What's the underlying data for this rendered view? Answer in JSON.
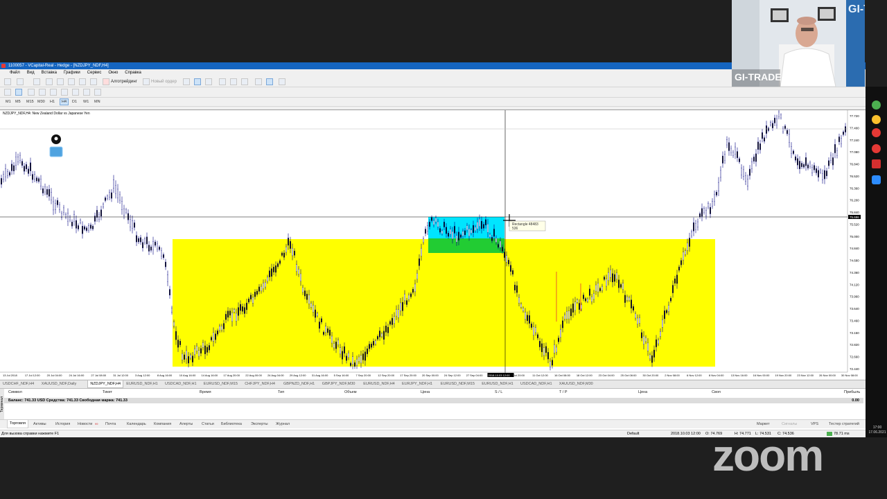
{
  "window": {
    "title": "1100057 - VCapital-Real - Hedge - [NZDJPY_NDF,H4]"
  },
  "menu": [
    "Файл",
    "Вид",
    "Вставка",
    "Графики",
    "Сервис",
    "Окно",
    "Справка"
  ],
  "toolbar": {
    "algotrading_label": "Алготрейдинг",
    "new_order_label": "Новый ордер"
  },
  "timeframes": [
    "M1",
    "M5",
    "M15",
    "M30",
    "H1",
    "H4",
    "D1",
    "W1",
    "MN"
  ],
  "active_timeframe": "H4",
  "chart": {
    "title": "NZDJPY_NDF,H4: New Zealand Dollar vs Japanese Yen",
    "tooltip_name": "Rectangle 48483",
    "tooltip_value": "536",
    "price_ticks": [
      "77.720",
      "77.400",
      "77.240",
      "77.080",
      "76.840",
      "76.520",
      "76.360",
      "76.200",
      "75.840",
      "75.520",
      "75.000",
      "74.840",
      "74.680",
      "74.360",
      "74.120",
      "73.960",
      "73.640",
      "73.460",
      "73.150",
      "72.820",
      "72.660",
      "72.440"
    ],
    "current_price_label": "75.696",
    "time_ticks": [
      "13 Jul 2018",
      "17 Jul 12:00",
      "20 Jul 04:00",
      "24 Jul 16:00",
      "27 Jul 08:00",
      "31 Jul 12:00",
      "3 Aug 12:00",
      "8 Aug 16:00",
      "10 Aug 16:00",
      "14 Aug 16:00",
      "17 Aug 20:00",
      "22 Aug 00:00",
      "24 Aug 04:00",
      "29 Aug 12:00",
      "31 Aug 16:00",
      "5 Sep 16:00",
      "7 Sep 20:00",
      "12 Sep 20:00",
      "17 Sep 20:00",
      "20 Sep 00:00",
      "24 Sep 12:00",
      "27 Sep 04:00",
      "2018.10.03 12:00",
      "1 Oct 20:00",
      "11 Oct 12:00",
      "16 Oct 08:00",
      "18 Oct 12:00",
      "23 Oct 04:00",
      "25 Oct 08:00",
      "30 Oct 20:00",
      "2 Nov 08:00",
      "6 Nov 12:00",
      "8 Nov 04:00",
      "13 Nov 16:00",
      "16 Nov 00:00",
      "19 Nov 20:00",
      "23 Nov 12:00",
      "26 Nov 00:00",
      "30 Nov 08:00"
    ],
    "colors": {
      "yellow_zone": "#ffff00",
      "cyan_zone": "#00e5ff",
      "green_zone": "#22cc33",
      "candle": "#000080"
    }
  },
  "symbol_tabs": [
    "USDCHF_NDF,H4",
    "XAUUSD_NDF,Daily",
    "NZDJPY_NDF,H4",
    "EURUSD_NDF,H1",
    "USDCAD_NDF,H1",
    "EURUSD_NDF,M15",
    "CHFJPY_NDF,H4",
    "GBPNZD_NDF,H1",
    "GBPJPY_NDF,M30",
    "EURUSD_NDF,H4",
    "EURJPY_NDF,H1",
    "EURUSD_NDF,M15",
    "EURUSD_NDF,H1",
    "USDCAD_NDF,H1",
    "XAUUSD_NDF,M30"
  ],
  "terminal": {
    "columns": [
      "Символ",
      "Тикет",
      "Время",
      "Тип",
      "Объем",
      "Цена",
      "S / L",
      "T / P",
      "Цена",
      "Своп",
      "Прибыль"
    ],
    "balance_text": "Баланс: 741.33 USD  Средства: 741.33  Свободная маржа: 741.33",
    "profit_value": "0.00",
    "side_label": "Терминал",
    "tabs": [
      "Торговля",
      "Активы",
      "История",
      "Новости",
      "Почта",
      "Календарь",
      "Компания",
      "Алерты",
      "Статьи",
      "Библиотека",
      "Эксперты",
      "Журнал"
    ],
    "news_badge": "99",
    "right_tabs": [
      "Маркет",
      "Сигналы",
      "VPS",
      "Тестер стратегий"
    ]
  },
  "status": {
    "help_text": "Для вызова справки нажмите F1",
    "profile": "Default",
    "datetime": "2018.10.03 12:00",
    "open": "O: 74.769",
    "high": "H: 74.771",
    "low": "L: 74.531",
    "close": "C: 74.536",
    "ping": "78.71 ms"
  },
  "webcam": {
    "brand": "GI-TRADE",
    "wall_text": "GI-T"
  },
  "overlay": {
    "zoom_logo": "zoom",
    "clock_time": "17:00",
    "clock_date": "17.06.2021"
  }
}
